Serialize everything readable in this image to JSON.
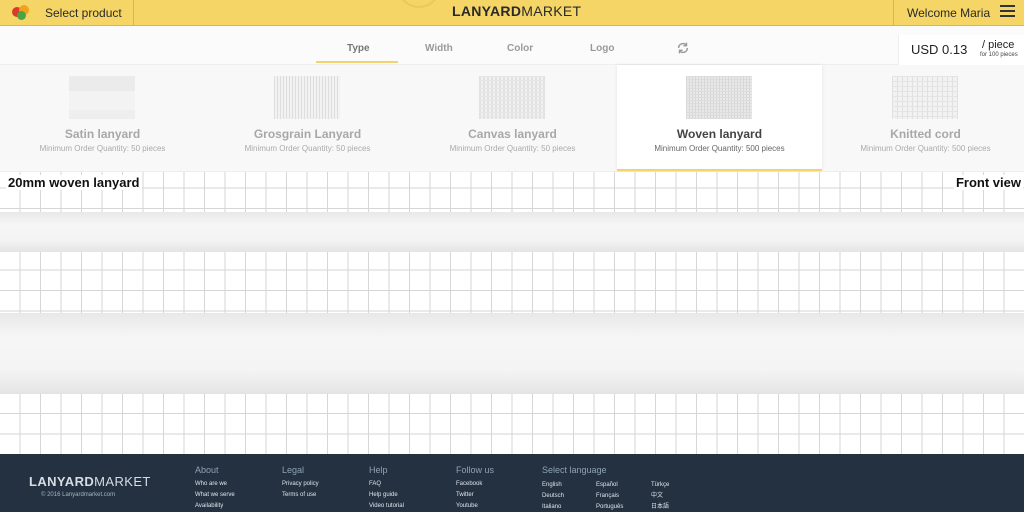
{
  "header": {
    "select_product": "Select product",
    "logo_bold": "LANYARD",
    "logo_light": "MARKET",
    "welcome": "Welcome Maria"
  },
  "tabs": [
    {
      "label": "Type",
      "active": true
    },
    {
      "label": "Width",
      "active": false
    },
    {
      "label": "Color",
      "active": false
    },
    {
      "label": "Logo",
      "active": false
    }
  ],
  "price": {
    "amount": "USD 0.13",
    "unit": "/ piece",
    "note": "for 100 pieces"
  },
  "products": [
    {
      "name": "Satin lanyard",
      "moq": "Minimum Order Quantity: 50 pieces",
      "selected": false
    },
    {
      "name": "Grosgrain Lanyard",
      "moq": "Minimum Order Quantity: 50 pieces",
      "selected": false
    },
    {
      "name": "Canvas lanyard",
      "moq": "Minimum Order Quantity: 50 pieces",
      "selected": false
    },
    {
      "name": "Woven lanyard",
      "moq": "Minimum Order Quantity: 500 pieces",
      "selected": true
    },
    {
      "name": "Knitted cord",
      "moq": "Minimum Order Quantity: 500 pieces",
      "selected": false
    }
  ],
  "preview": {
    "title": "20mm woven lanyard",
    "view": "Front view"
  },
  "footer": {
    "logo_bold": "LANYARD",
    "logo_light": "MARKET",
    "copyright": "© 2016 Lanyardmarket.com",
    "columns": [
      {
        "heading": "About",
        "links": [
          "Who are we",
          "What we serve",
          "Availability"
        ]
      },
      {
        "heading": "Legal",
        "links": [
          "Privacy policy",
          "Terms of use"
        ]
      },
      {
        "heading": "Help",
        "links": [
          "FAQ",
          "Help guide",
          "Video tutorial"
        ]
      },
      {
        "heading": "Follow us",
        "links": [
          "Facebook",
          "Twitter",
          "Youtube"
        ]
      }
    ],
    "language": {
      "heading": "Select language",
      "col1": [
        "English",
        "Deutsch",
        "Italiano"
      ],
      "col2": [
        "Español",
        "Français",
        "Português"
      ],
      "col3": [
        "Türkçe",
        "中文",
        "日本語"
      ]
    }
  },
  "colors": {
    "header_yellow": "#f5d566",
    "accent": "#f3d36b",
    "footer_bg": "#233140"
  }
}
